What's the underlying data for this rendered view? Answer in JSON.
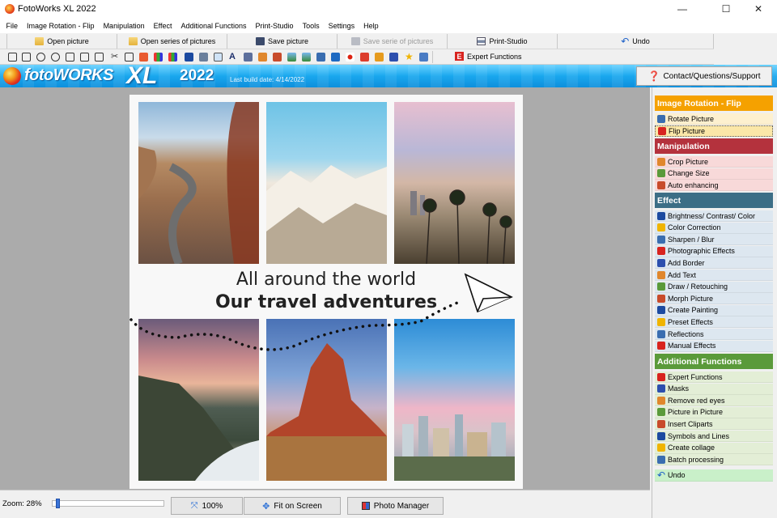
{
  "window": {
    "title": "FotoWorks XL 2022",
    "controls": {
      "minimize": "—",
      "maximize": "☐",
      "close": "✕"
    }
  },
  "menu": [
    "File",
    "Image Rotation - Flip",
    "Manipulation",
    "Effect",
    "Additional Functions",
    "Print-Studio",
    "Tools",
    "Settings",
    "Help"
  ],
  "toolbar": {
    "open_picture": "Open picture",
    "open_series": "Open series of pictures",
    "save_picture": "Save picture",
    "save_series": "Save serie of pictures",
    "print_studio": "Print-Studio",
    "undo": "Undo",
    "expert_functions": "Expert Functions"
  },
  "banner": {
    "logo_text": "fotoWORKS",
    "logo_xl": "XL",
    "logo_year": "2022",
    "build_date": "Last build date: 4/14/2022",
    "contact_label": "Contact/Questions/Support"
  },
  "canvas": {
    "headline_line1": "All around the world",
    "headline_line2": "Our travel adventures"
  },
  "panel": {
    "sections": [
      {
        "title": "Image Rotation - Flip",
        "color": "#f5a100",
        "item_bg": "#fdf0cf",
        "items": [
          "Rotate Picture",
          "Flip Picture"
        ]
      },
      {
        "title": "Manipulation",
        "color": "#b4323d",
        "item_bg": "#f8d9d9",
        "items": [
          "Crop Picture",
          "Change Size",
          "Auto enhancing"
        ]
      },
      {
        "title": "Effect",
        "color": "#3c6e86",
        "item_bg": "#dde7f0",
        "items": [
          "Brightness/ Contrast/ Color",
          "Color Correction",
          "Sharpen / Blur",
          "Photographic Effects",
          "Add Border",
          "Add Text",
          "Draw / Retouching",
          "Morph Picture",
          "Create Painting",
          "Preset Effects",
          "Reflections",
          "Manual Effects"
        ]
      },
      {
        "title": "Additional Functions",
        "color": "#5a9a3a",
        "item_bg": "#e3eed6",
        "items": [
          "Expert Functions",
          "Masks",
          "Remove red eyes",
          "Picture in Picture",
          "Insert Cliparts",
          "Symbols and Lines",
          "Create collage",
          "Batch processing"
        ]
      }
    ],
    "undo": "Undo",
    "undo_bg": "#c9f0c9",
    "selected_item": "Flip Picture"
  },
  "statusbar": {
    "zoom_label": "Zoom: 28%",
    "zoom_fraction": 0.03,
    "btn_100": "100%",
    "btn_fit": "Fit on Screen",
    "btn_photo_manager": "Photo Manager"
  }
}
